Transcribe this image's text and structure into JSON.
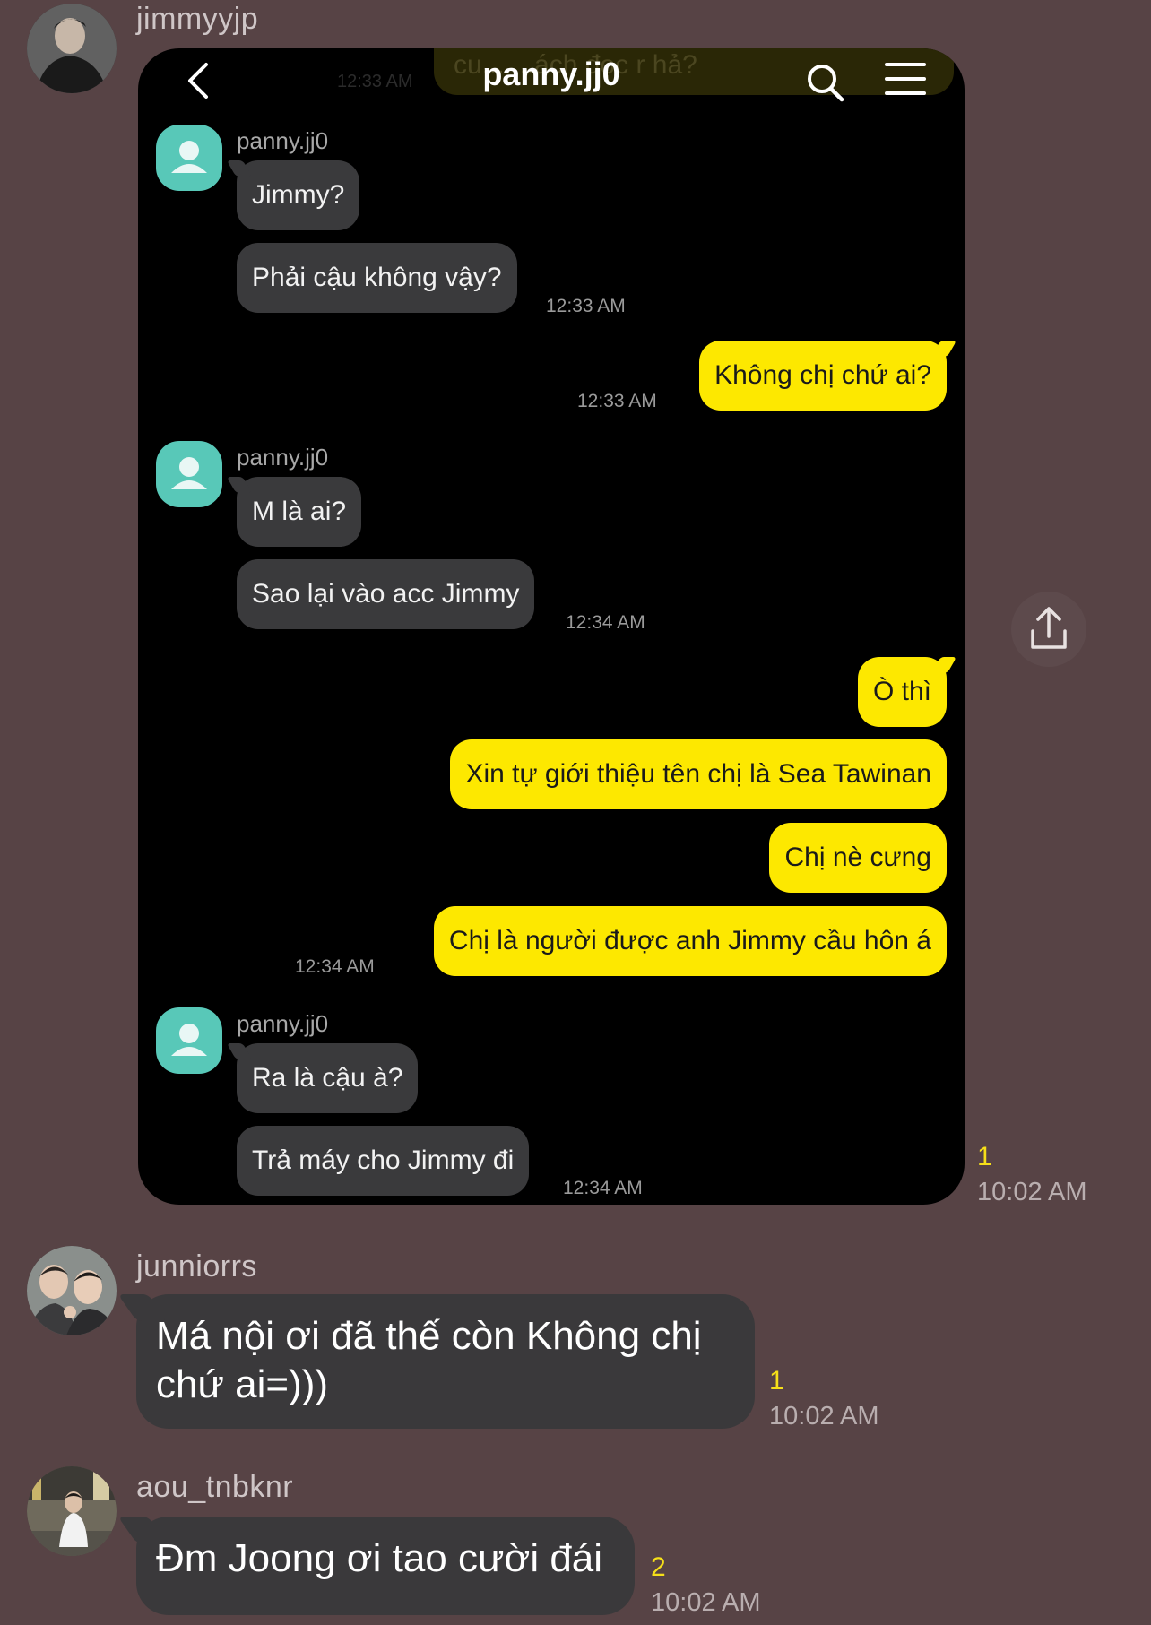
{
  "messages": [
    {
      "sender": "jimmyyjp",
      "read_count": "1",
      "time": "10:02 AM",
      "screenshot": {
        "title": "panny.jj0",
        "ghost_text": "cu... ...ách đọc r hả?",
        "ghost_time": "12:33 AM",
        "groups": [
          {
            "sender": "panny.jj0",
            "bubbles": [
              "Jimmy?",
              "Phải cậu không vậy?"
            ],
            "time": "12:33 AM"
          },
          {
            "outgoing": true,
            "bubbles": [
              "Không chị chứ ai?"
            ],
            "time": "12:33 AM"
          },
          {
            "sender": "panny.jj0",
            "bubbles": [
              "M là ai?",
              "Sao lại vào acc Jimmy"
            ],
            "time": "12:34 AM"
          },
          {
            "outgoing": true,
            "bubbles": [
              "Ò thì",
              "Xin tự giới thiệu tên chị là Sea Tawinan",
              "Chị nè cưng",
              "Chị là người được anh Jimmy cầu hôn á"
            ],
            "time": "12:34 AM"
          },
          {
            "sender": "panny.jj0",
            "bubbles": [
              "Ra là cậu à?",
              "Trả máy cho Jimmy đi"
            ],
            "time": "12:34 AM"
          }
        ]
      }
    },
    {
      "sender": "junniorrs",
      "text": "Má nội ơi đã thế còn Không chị chứ ai=)))",
      "read_count": "1",
      "time": "10:02 AM"
    },
    {
      "sender": "aou_tnbknr",
      "text": "Đm Joong ơi tao cười đái",
      "read_count": "2",
      "time": "10:02 AM"
    }
  ],
  "icons": {
    "back": "chevron-left-icon",
    "search": "search-icon",
    "menu": "hamburger-menu-icon",
    "share": "share-icon",
    "default_avatar": "person-icon"
  },
  "colors": {
    "background": "#574345",
    "incoming_bubble": "#3a393b",
    "outgoing_bubble": "#fde800",
    "read_count": "#f6e019",
    "profile_placeholder": "#58c8b8"
  }
}
